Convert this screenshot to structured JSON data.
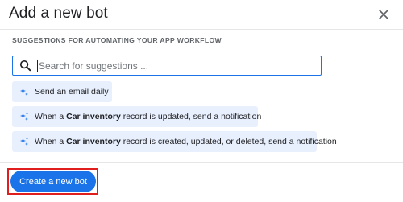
{
  "dialog": {
    "title": "Add a new bot",
    "close_icon": "close-icon"
  },
  "suggestions": {
    "label": "SUGGESTIONS FOR AUTOMATING YOUR APP WORKFLOW",
    "search_placeholder": "Search for suggestions ...",
    "search_value": "",
    "search_icon": "search-icon",
    "item_icon": "sparkle-icon",
    "items": [
      {
        "text": "Send an email daily"
      },
      {
        "prefix": "When a ",
        "bold": "Car inventory",
        "suffix": " record is updated, send a notification"
      },
      {
        "prefix": "When a ",
        "bold": "Car inventory",
        "suffix": " record is created, updated, or deleted, send a notification"
      }
    ]
  },
  "footer": {
    "create_label": "Create a new bot"
  },
  "colors": {
    "accent": "#1a73e8",
    "chip_background": "#e8f0fe",
    "highlight_border": "#e11e1e"
  }
}
